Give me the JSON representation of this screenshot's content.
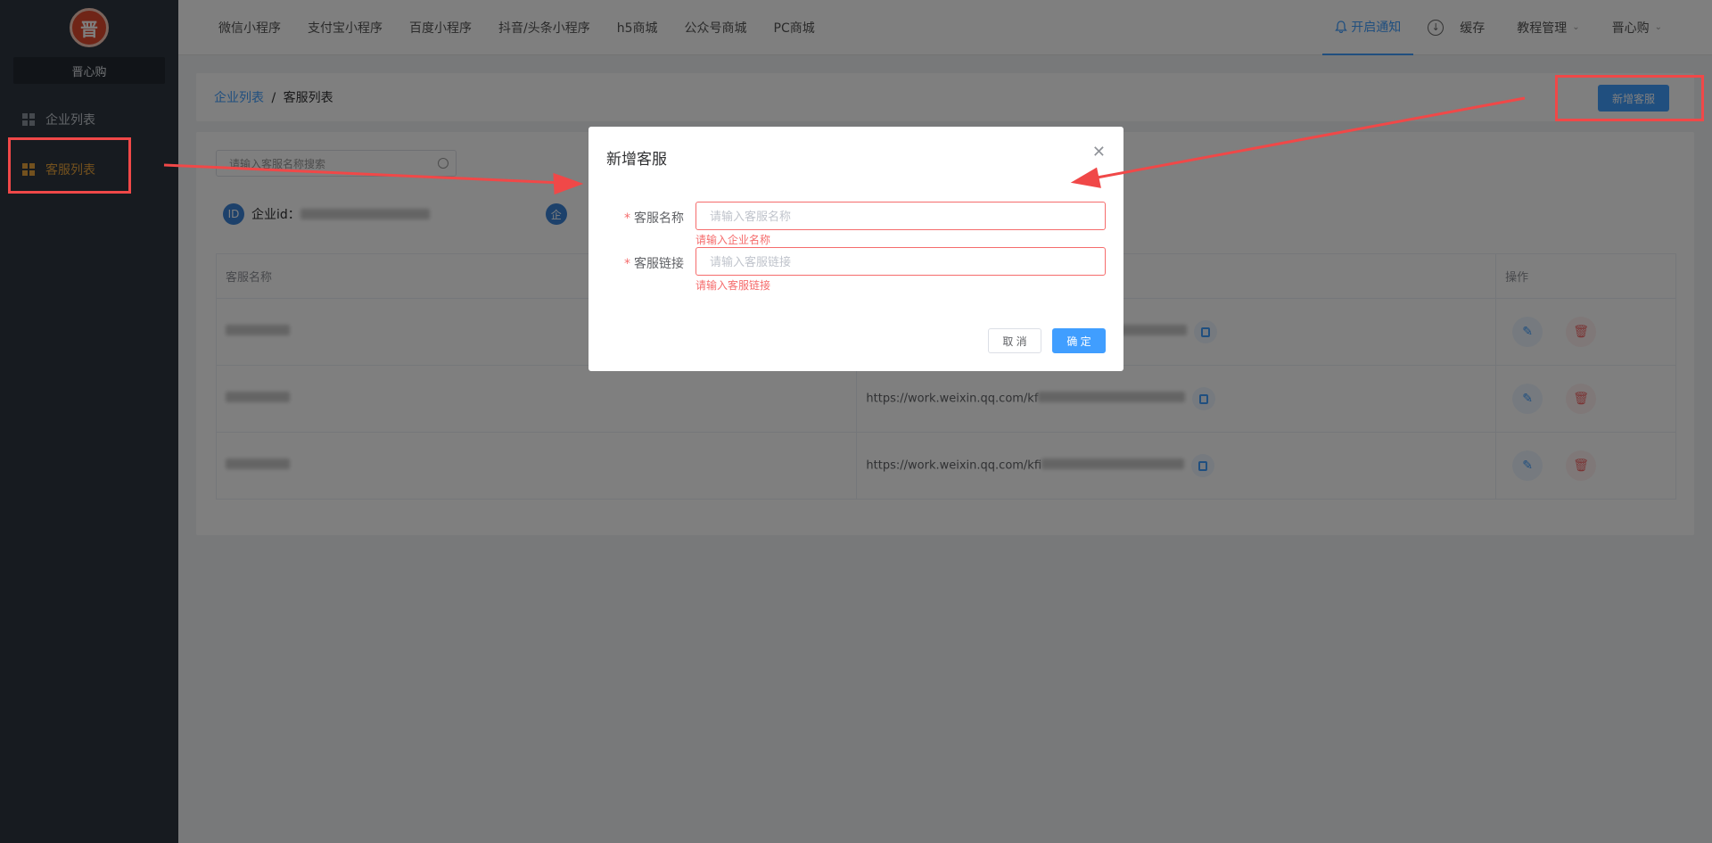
{
  "sidebar": {
    "logo_text": "晋",
    "brand": "晋心购",
    "items": [
      {
        "label": "企业列表",
        "active": false
      },
      {
        "label": "客服列表",
        "active": true
      }
    ]
  },
  "topnav": {
    "tabs": [
      "微信小程序",
      "支付宝小程序",
      "百度小程序",
      "抖音/头条小程序",
      "h5商城",
      "公众号商城",
      "PC商城"
    ],
    "notice": "开启通知",
    "cache": "缓存",
    "tutorial": "教程管理",
    "user": "晋心购"
  },
  "breadcrumb": {
    "parent": "企业列表",
    "separator": "/",
    "current": "客服列表"
  },
  "add_button": "新增客服",
  "search": {
    "placeholder": "请输入客服名称搜索"
  },
  "company": {
    "id_label": "企业id：",
    "id_icon": "ID",
    "name_icon": "企"
  },
  "table": {
    "headers": [
      "客服名称",
      "",
      "操作"
    ],
    "rows": [
      {
        "url": ""
      },
      {
        "url": "https://work.weixin.qq.com/kf"
      },
      {
        "url": "https://work.weixin.qq.com/kfi"
      }
    ]
  },
  "dialog": {
    "title": "新增客服",
    "fields": [
      {
        "label": "客服名称",
        "placeholder": "请输入客服名称",
        "error": "请输入企业名称"
      },
      {
        "label": "客服链接",
        "placeholder": "请输入客服链接",
        "error": "请输入客服链接"
      }
    ],
    "cancel": "取 消",
    "confirm": "确 定"
  },
  "colors": {
    "primary": "#409eff",
    "danger": "#f56c6c",
    "annotation": "#f04848",
    "sidebar": "#2f3640"
  }
}
